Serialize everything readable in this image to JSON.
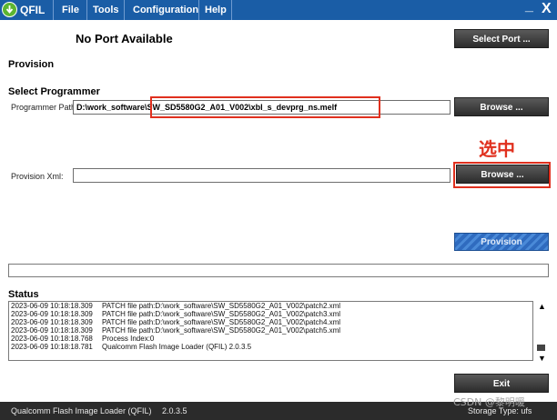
{
  "window": {
    "title": "QFIL",
    "minimize_glyph": "_",
    "close_glyph": "X"
  },
  "menu": [
    "File",
    "Tools",
    "Configuration",
    "Help"
  ],
  "port": {
    "status": "No Port Available",
    "select_button": "Select Port ..."
  },
  "sections": {
    "provision": "Provision",
    "select_programmer": "Select Programmer",
    "status": "Status"
  },
  "programmer": {
    "label": "Programmer Path",
    "value": "D:\\work_software\\SW_SD5580G2_A01_V002\\xbl_s_devprg_ns.melf",
    "browse_button": "Browse ..."
  },
  "provision_xml": {
    "label": "Provision Xml:",
    "value": "",
    "browse_button": "Browse ..."
  },
  "annotation": {
    "text": "选中",
    "color": "#e0301e"
  },
  "provision_button": "Provision",
  "log": [
    {
      "time": "2023-06-09 10:18:18.309",
      "msg": "PATCH file path:D:\\work_software\\SW_SD5580G2_A01_V002\\patch2.xml"
    },
    {
      "time": "2023-06-09 10:18:18.309",
      "msg": "PATCH file path:D:\\work_software\\SW_SD5580G2_A01_V002\\patch3.xml"
    },
    {
      "time": "2023-06-09 10:18:18.309",
      "msg": "PATCH file path:D:\\work_software\\SW_SD5580G2_A01_V002\\patch4.xml"
    },
    {
      "time": "2023-06-09 10:18:18.309",
      "msg": "PATCH file path:D:\\work_software\\SW_SD5580G2_A01_V002\\patch5.xml"
    },
    {
      "time": "2023-06-09 10:18:18.768",
      "msg": "Process Index:0"
    },
    {
      "time": "2023-06-09 10:18:18.781",
      "msg": "Qualcomm Flash Image Loader (QFIL) 2.0.3.5"
    }
  ],
  "exit_button": "Exit",
  "statusbar": {
    "app": "Qualcomm Flash Image Loader (QFIL)",
    "version": "2.0.3.5",
    "storage": "Storage Type:   ufs"
  },
  "watermark": "CSDN @黎明暖",
  "colors": {
    "titlebar": "#1a5da6",
    "highlight": "#e0301e",
    "provision": "#2f6bbf"
  }
}
